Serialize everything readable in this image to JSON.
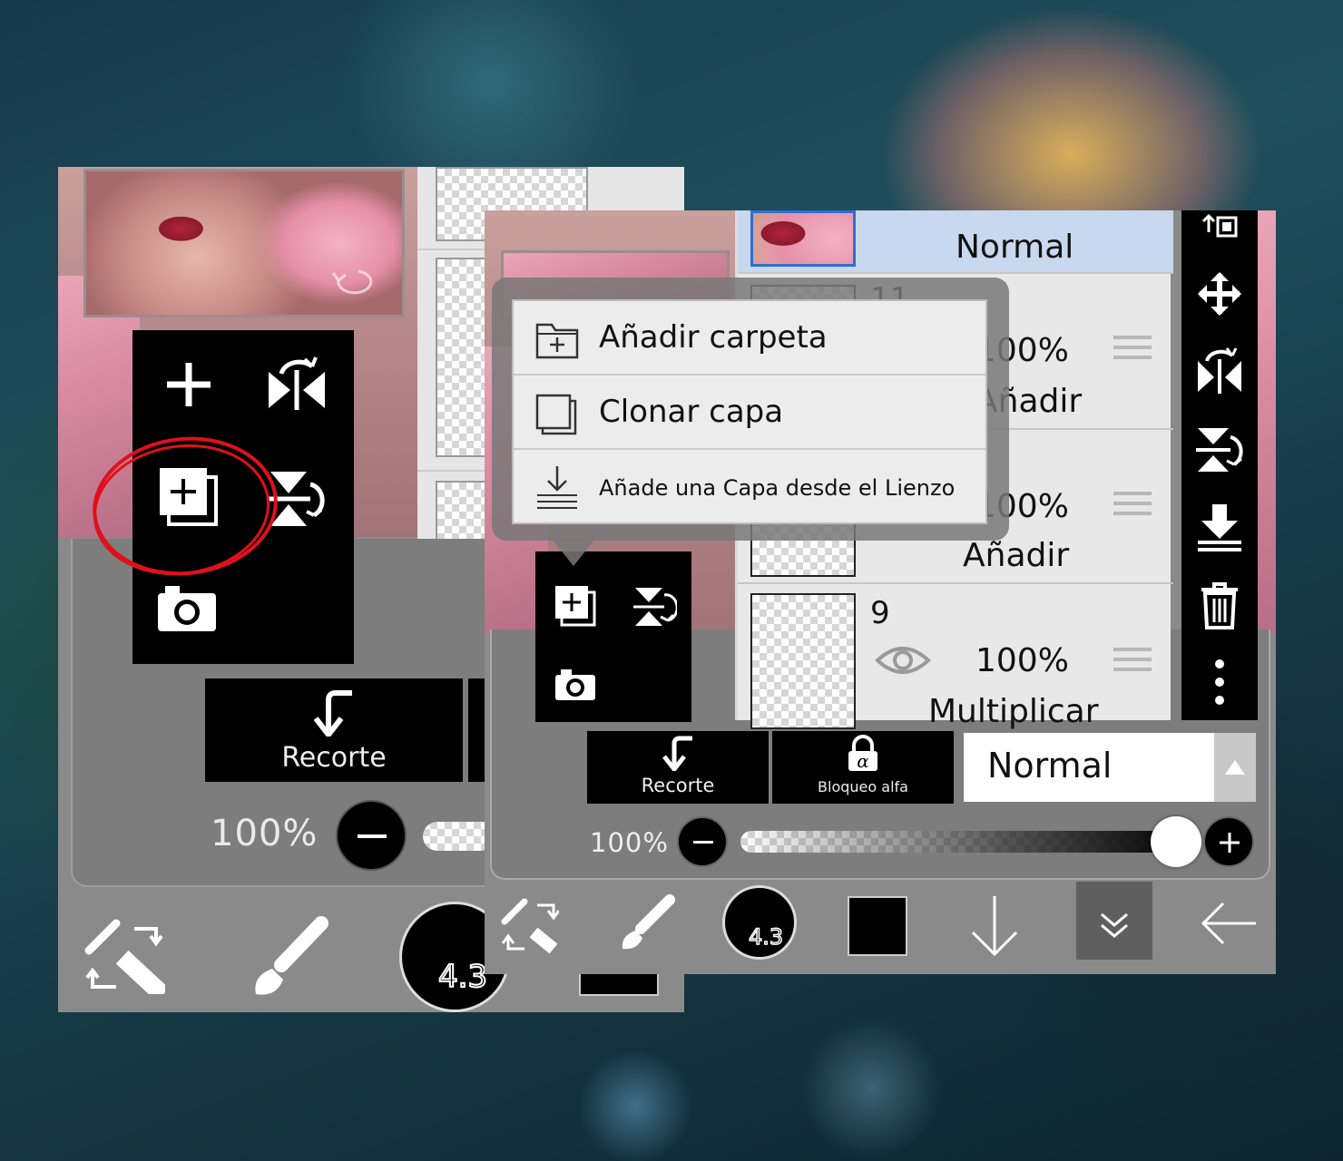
{
  "left_panel": {
    "recorte_label": "Recorte",
    "opacity_label": "100%",
    "brush_size": "4.3"
  },
  "popup_menu": {
    "items": [
      {
        "label": "Añadir carpeta",
        "icon": "add-folder-icon"
      },
      {
        "label": "Clonar capa",
        "icon": "clone-layer-icon"
      },
      {
        "label": "Añade una Capa desde el Lienzo",
        "icon": "layer-from-canvas-icon"
      }
    ]
  },
  "layers": [
    {
      "number": "",
      "opacity": "",
      "mode": "Normal",
      "selected": true
    },
    {
      "number": "11",
      "opacity": "100%",
      "mode": "Añadir",
      "selected": false
    },
    {
      "number": "",
      "opacity": "100%",
      "mode": "Añadir",
      "selected": false
    },
    {
      "number": "9",
      "opacity": "100%",
      "mode": "Multiplicar",
      "selected": false
    }
  ],
  "right_panel": {
    "recorte_label": "Recorte",
    "bloqueo_label": "Bloqueo alfa",
    "blend_mode": "Normal",
    "opacity_label": "100%",
    "opacity_value": 1.0,
    "brush_size": "4.3"
  },
  "colors": {
    "highlight": "#e0101a",
    "selected_layer": "#c8d8ee",
    "toolbar": "#8a8a8a"
  }
}
